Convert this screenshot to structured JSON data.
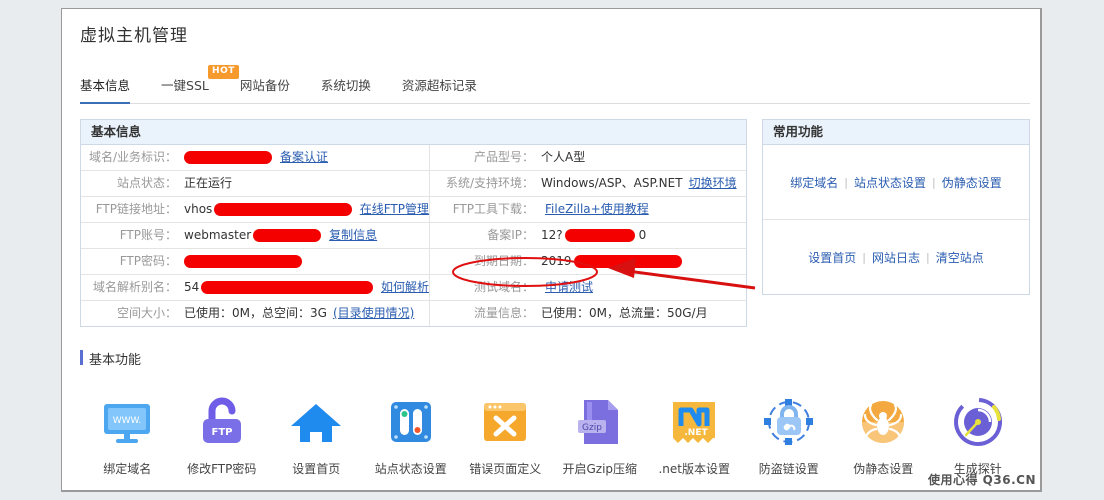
{
  "page": {
    "title": "虚拟主机管理",
    "watermark": "使用心得 Q36.CN"
  },
  "tabs": [
    {
      "label": "基本信息",
      "active": true,
      "badge": ""
    },
    {
      "label": "一键SSL",
      "active": false,
      "badge": "HOT"
    },
    {
      "label": "网站备份",
      "active": false,
      "badge": ""
    },
    {
      "label": "系统切换",
      "active": false,
      "badge": ""
    },
    {
      "label": "资源超标记录",
      "active": false,
      "badge": ""
    }
  ],
  "info_panel": {
    "header": "基本信息",
    "rows": [
      {
        "left": {
          "label": "域名/业务标识：",
          "value": "",
          "redact": 88,
          "link": "备案认证"
        },
        "right": {
          "label": "产品型号：",
          "value": "个人A型",
          "redact": 0,
          "link": ""
        }
      },
      {
        "left": {
          "label": "站点状态：",
          "value": "正在运行",
          "redact": 0,
          "link": ""
        },
        "right": {
          "label": "系统/支持环境：",
          "value": "Windows/ASP、ASP.NET",
          "redact": 0,
          "link": "切换环境"
        }
      },
      {
        "left": {
          "label": "FTP链接地址：",
          "value": "vhos",
          "redact": 138,
          "link": "在线FTP管理"
        },
        "right": {
          "label": "FTP工具下载：",
          "value": "",
          "redact": 0,
          "link": "FileZilla+使用教程"
        }
      },
      {
        "left": {
          "label": "FTP账号：",
          "value": "webmaster",
          "redact": 68,
          "link": "复制信息"
        },
        "right": {
          "label": "备案IP：",
          "value": "12?",
          "redact": 70,
          "value_tail": "0",
          "link": ""
        }
      },
      {
        "left": {
          "label": "FTP密码：",
          "value": "",
          "redact": 118,
          "link": ""
        },
        "right": {
          "label": "到期日期：",
          "value": "2019",
          "redact": 108,
          "link": ""
        }
      },
      {
        "left": {
          "label": "域名解析别名：",
          "value": "54",
          "redact": 172,
          "link": "如何解析"
        },
        "right": {
          "label": "测试域名：",
          "value": "",
          "redact": 0,
          "link": "申请测试",
          "circled": true
        }
      },
      {
        "left": {
          "label": "空间大小：",
          "value": "已使用：0M，总空间：3G",
          "redact": 0,
          "link": "(目录使用情况)"
        },
        "right": {
          "label": "流量信息：",
          "value": "已使用：0M，总流量：50G/月",
          "redact": 0,
          "link": ""
        }
      }
    ]
  },
  "common_panel": {
    "header": "常用功能",
    "groups": [
      {
        "links": [
          "绑定域名",
          "站点状态设置",
          "伪静态设置"
        ]
      },
      {
        "links": [
          "设置首页",
          "网站日志",
          "清空站点"
        ]
      }
    ]
  },
  "functions": {
    "heading": "基本功能",
    "items": [
      {
        "label": "绑定域名",
        "icon": "monitor-www-icon",
        "color": "#4ca6f0"
      },
      {
        "label": "修改FTP密码",
        "icon": "ftp-padlock-icon",
        "color": "#6f5de8"
      },
      {
        "label": "设置首页",
        "icon": "home-icon",
        "color": "#1f8bef"
      },
      {
        "label": "站点状态设置",
        "icon": "toggle-switch-icon",
        "color": "#2f8ae0"
      },
      {
        "label": "错误页面定义",
        "icon": "window-error-icon",
        "color": "#f5a82c"
      },
      {
        "label": "开启Gzip压缩",
        "icon": "gzip-file-icon",
        "color": "#7b6fe0"
      },
      {
        "label": ".net版本设置",
        "icon": "dotnet-icon",
        "color": "#f5b83d"
      },
      {
        "label": "防盗链设置",
        "icon": "chain-lock-icon",
        "color": "#3f7fe0"
      },
      {
        "label": "伪静态设置",
        "icon": "spider-icon",
        "color": "#f3a93f"
      },
      {
        "label": "生成探针",
        "icon": "radar-probe-icon",
        "color": "#6b5fd6"
      }
    ]
  },
  "annotation": {
    "ellipse_color": "#e01010",
    "arrow_color": "#d81010"
  }
}
